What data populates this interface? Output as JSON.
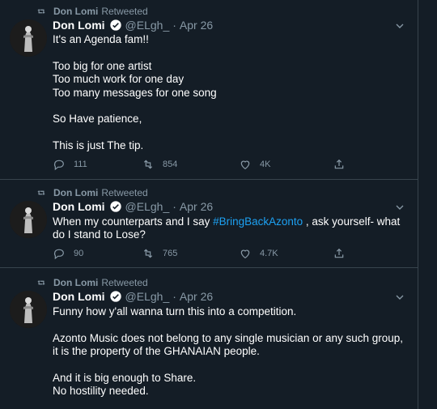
{
  "colors": {
    "background": "#141d26",
    "text": "#ffffff",
    "muted": "#8899a6",
    "link": "#1da1f2",
    "divider": "#38444d"
  },
  "tweets": [
    {
      "retweeted_by": "Don Lomi",
      "retweeted_label": "Retweeted",
      "name": "Don Lomi",
      "handle": "@ELgh_",
      "dot": "·",
      "date": "Apr 26",
      "lines": [
        "It's an Agenda fam!!",
        "",
        "Too big for one artist",
        "Too much work for one day",
        "Too many messages for one song",
        "",
        "So Have patience,",
        "",
        "This is just The tip."
      ],
      "replies": "111",
      "retweets": "854",
      "likes": "4K"
    },
    {
      "retweeted_by": "Don Lomi",
      "retweeted_label": "Retweeted",
      "name": "Don Lomi",
      "handle": "@ELgh_",
      "dot": "·",
      "date": "Apr 26",
      "text_before": "When my counterparts and I say ",
      "hashtag": "#BringBackAzonto",
      "text_after": " , ask yourself- what do I stand to Lose?",
      "replies": "90",
      "retweets": "765",
      "likes": "4.7K"
    },
    {
      "retweeted_by": "Don Lomi",
      "retweeted_label": "Retweeted",
      "name": "Don Lomi",
      "handle": "@ELgh_",
      "dot": "·",
      "date": "Apr 26",
      "lines": [
        "Funny how y'all wanna turn this into a competition.",
        "",
        "Azonto Music does not belong to any single musician or any such group, it is the property of the GHANAIAN people.",
        "",
        "And it is big enough to Share.",
        "No hostility needed."
      ]
    }
  ],
  "icons": {
    "retweet_indicator": "retweet-icon",
    "verified": "verified-badge-icon",
    "caret": "chevron-down-icon",
    "reply": "reply-icon",
    "retweet": "retweet-icon",
    "like": "heart-icon",
    "share": "share-icon"
  }
}
